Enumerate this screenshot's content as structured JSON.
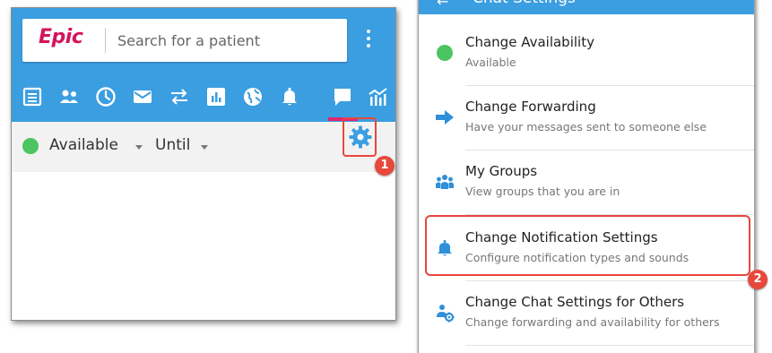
{
  "left_panel": {
    "logo_text": "Epic",
    "search": {
      "placeholder": "Search for a patient"
    },
    "toolbar_icons": [
      "worklist-icon",
      "patients-icon",
      "clock-icon",
      "mail-icon",
      "transfer-icon",
      "chart-icon",
      "globe-icon",
      "bell-icon",
      "chat-icon",
      "report-icon"
    ],
    "active_tab": "chat-icon",
    "status": {
      "label": "Available",
      "until_label": "Until"
    },
    "callout_number": "1"
  },
  "right_panel": {
    "header_title": "Chat Settings",
    "items": [
      {
        "title": "Change Availability",
        "subtitle": "Available",
        "icon": "green-status-dot-icon"
      },
      {
        "title": "Change Forwarding",
        "subtitle": "Have your messages sent to someone else",
        "icon": "arrow-right-icon"
      },
      {
        "title": "My Groups",
        "subtitle": "View groups that you are in",
        "icon": "groups-icon"
      },
      {
        "title": "Change Notification Settings",
        "subtitle": "Configure notification types and sounds",
        "icon": "bell-icon"
      },
      {
        "title": "Change Chat Settings for Others",
        "subtitle": "Change forwarding and availability for others",
        "icon": "user-settings-icon"
      }
    ],
    "callout_number": "2"
  },
  "colors": {
    "header_blue": "#3b9ee0",
    "accent_pink": "#e0266e",
    "callout_red": "#e8473c",
    "available_green": "#4cc462"
  }
}
